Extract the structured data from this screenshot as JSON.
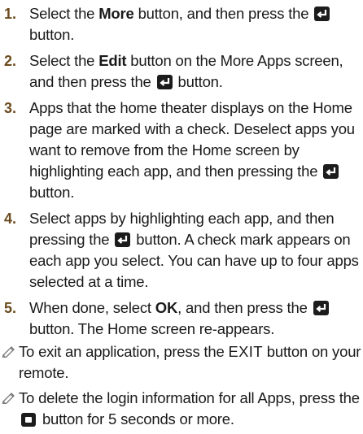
{
  "icons": {
    "enter": "enter-button-icon",
    "square": "square-button-icon",
    "note": "pencil-note-icon"
  },
  "steps": [
    {
      "num": "1.",
      "a": "Select the ",
      "b": "More",
      "c": " button, and then press the ",
      "d": " button."
    },
    {
      "num": "2.",
      "a": "Select the ",
      "b": "Edit",
      "c": " button on the More Apps screen, and then press the ",
      "d": " button."
    },
    {
      "num": "3.",
      "a": "Apps that the home theater displays on the Home page are marked with a check. Deselect apps you want to remove from the Home screen by highlighting each app, and then pressing the ",
      "d": " button."
    },
    {
      "num": "4.",
      "a": "Select apps by highlighting each app, and then pressing the ",
      "d": " button. A check mark appears on each app you select. You can have up to four apps selected at a time."
    },
    {
      "num": "5.",
      "a": "When done, select ",
      "b": "OK",
      "c": ", and then press the ",
      "d": " button. The Home screen re-appears."
    }
  ],
  "notes": [
    {
      "a": "To exit an application, press the ",
      "b": "EXIT",
      "c": " button on your remote."
    },
    {
      "a": "To delete the login information for all Apps, press the ",
      "c": " button for 5 seconds or more."
    }
  ]
}
